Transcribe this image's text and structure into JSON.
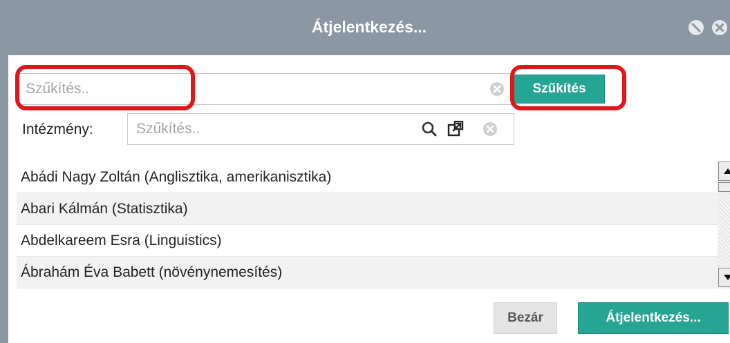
{
  "dialog": {
    "title": "Átjelentkezés...",
    "title_buttons": [
      "restore-icon",
      "close-icon"
    ]
  },
  "search": {
    "placeholder": "Szűkítés..",
    "value": "",
    "button_label": "Szűkítés"
  },
  "institution": {
    "label": "Intézmény:",
    "placeholder": "Szűkítés..",
    "value": "",
    "icons": [
      "search-icon",
      "external-link-icon",
      "clear-icon"
    ]
  },
  "list": {
    "items": [
      "Abádi Nagy Zoltán (Anglisztika, amerikanisztika)",
      "Abari Kálmán (Statisztika)",
      "Abdelkareem Esra (Linguistics)",
      "Ábrahám Éva Babett (növénynemesítés)"
    ]
  },
  "footer": {
    "close_label": "Bezár",
    "confirm_label": "Átjelentkezés..."
  },
  "colors": {
    "titlebar": "#8c97a4",
    "accent": "#26a594",
    "highlight": "#e0161b"
  }
}
